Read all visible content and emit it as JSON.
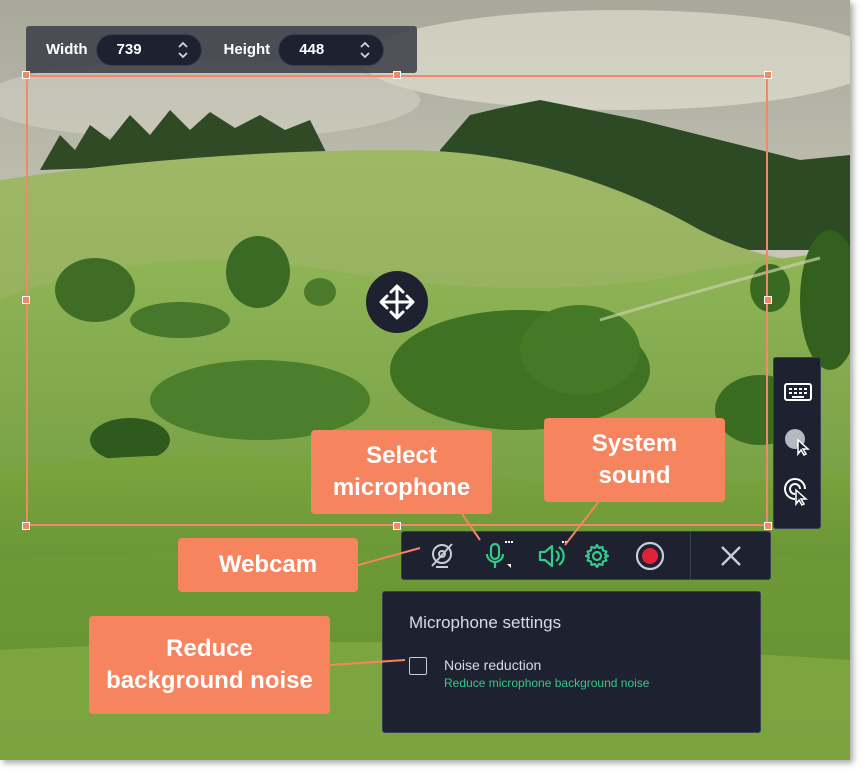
{
  "size_bar": {
    "width_label": "Width",
    "width_value": "739",
    "height_label": "Height",
    "height_value": "448"
  },
  "recording_toolbar": {
    "buttons": [
      "webcam-off-icon",
      "microphone-icon",
      "system-sound-icon",
      "settings-icon",
      "record-icon",
      "close-icon"
    ],
    "accent_color": "#35c98a",
    "record_color": "#e0223a"
  },
  "side_toolbar": {
    "buttons": [
      "keyboard-icon",
      "cursor-highlight-icon",
      "click-effect-icon"
    ]
  },
  "mic_settings": {
    "title": "Microphone settings",
    "option_label": "Noise reduction",
    "option_description": "Reduce microphone background noise",
    "option_checked": false
  },
  "callouts": {
    "webcam": "Webcam",
    "microphone": "Select\nmicrophone",
    "system_sound": "System\nsound",
    "noise": "Reduce\nbackground noise"
  },
  "colors": {
    "selection": "#f0896a",
    "callout": "#f5845f",
    "panel_bg": "#1d2130"
  }
}
